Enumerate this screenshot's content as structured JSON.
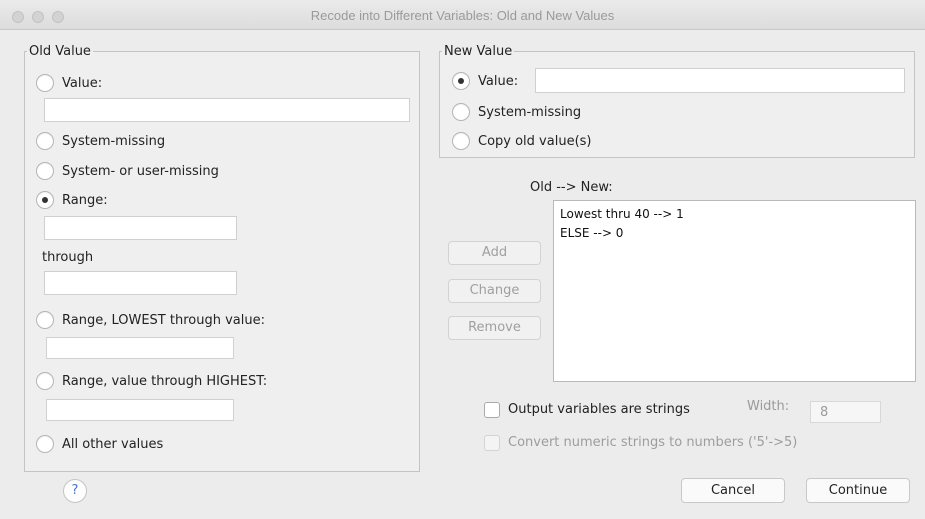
{
  "window": {
    "title": "Recode into Different Variables: Old and New Values"
  },
  "old_value": {
    "legend": "Old Value",
    "value_label": "Value:",
    "value_input": "",
    "value_selected": false,
    "system_missing_label": "System-missing",
    "system_or_user_missing_label": "System- or user-missing",
    "range_label": "Range:",
    "range_selected": true,
    "range_from": "",
    "through_label": "through",
    "range_to": "",
    "range_lowest_label": "Range, LOWEST through value:",
    "range_lowest_input": "",
    "range_highest_label": "Range, value through HIGHEST:",
    "range_highest_input": "",
    "all_other_label": "All other values"
  },
  "new_value": {
    "legend": "New Value",
    "value_label": "Value:",
    "value_selected": true,
    "value_input": "",
    "system_missing_label": "System-missing",
    "copy_old_label": "Copy old value(s)"
  },
  "mapping": {
    "header": "Old --> New:",
    "items": [
      "Lowest thru 40 --> 1",
      "ELSE --> 0"
    ],
    "add_label": "Add",
    "change_label": "Change",
    "remove_label": "Remove"
  },
  "options": {
    "output_strings_label": "Output variables are strings",
    "output_strings_checked": false,
    "width_label": "Width:",
    "width_value": "8",
    "convert_numeric_label": "Convert numeric strings to numbers ('5'->5)",
    "convert_numeric_checked": false
  },
  "footer": {
    "help_label": "?",
    "cancel_label": "Cancel",
    "continue_label": "Continue"
  }
}
